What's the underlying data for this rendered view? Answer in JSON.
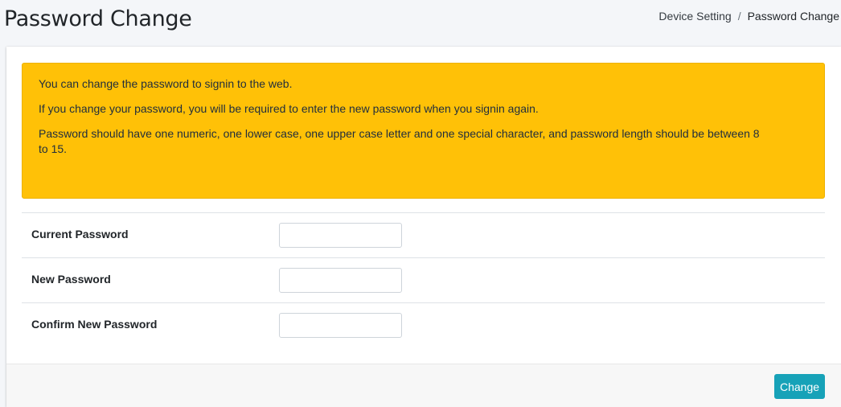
{
  "header": {
    "title": "Password Change",
    "breadcrumb": [
      {
        "label": "Device Setting"
      },
      {
        "label": "Password Change"
      }
    ],
    "breadcrumb_separator": "/"
  },
  "alert": {
    "color": "#ffc107",
    "lines": [
      "You can change the password to signin to the web.",
      "If you change your password, you will be required to enter the new password when you signin again.",
      "Password should have one numeric, one lower case, one upper case letter and one special character, and password length should be between 8 to 15."
    ]
  },
  "form": {
    "fields": [
      {
        "label": "Current Password",
        "value": "",
        "placeholder": ""
      },
      {
        "label": "New Password",
        "value": "",
        "placeholder": ""
      },
      {
        "label": "Confirm New Password",
        "value": "",
        "placeholder": ""
      }
    ]
  },
  "footer": {
    "change_label": "Change",
    "button_color": "#17a2b8"
  }
}
